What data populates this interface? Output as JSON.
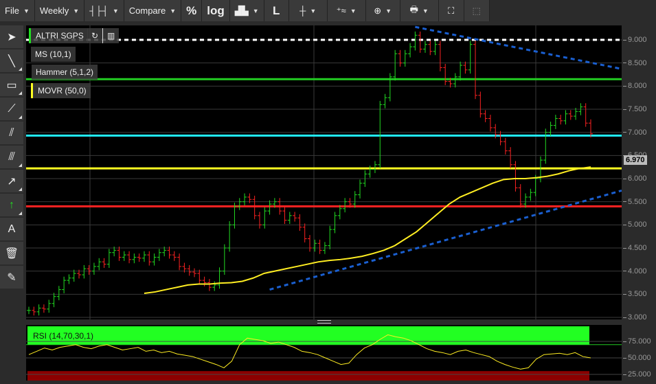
{
  "toolbar": {
    "file": "File",
    "period": "Weekly",
    "compare": "Compare",
    "percent": "%",
    "log": "log",
    "linear": "L"
  },
  "left_tools": [
    "pointer",
    "line",
    "rectangle",
    "fan",
    "parallel-lines",
    "fibonacci",
    "arrow",
    "up-arrow",
    "text",
    "trash",
    "ruler"
  ],
  "left_tools_text_label": "A",
  "legends": {
    "symbol": "ALTRI SGPS",
    "ms": "MS (10,1)",
    "hammer": "Hammer (5,1,2)",
    "movr": "MOVR (50,0)",
    "rsi": "RSI (14,70,30,1)"
  },
  "last_price": "6.970",
  "price_ticks": [
    "9.000",
    "8.500",
    "8.000",
    "7.500",
    "7.000",
    "6.500",
    "6.000",
    "5.500",
    "5.000",
    "4.500",
    "4.000",
    "3.500",
    "3.000"
  ],
  "rsi_ticks": [
    "75.000",
    "50.000",
    "25.000"
  ],
  "colors": {
    "up": "#22dd22",
    "down": "#ff2222",
    "ma": "#ffee22",
    "cyan": "#22eeff",
    "trend": "#1a5fd0"
  },
  "chart_data": {
    "type": "ohlc",
    "ylim": [
      3,
      9.3
    ],
    "closes": [
      3.15,
      3.12,
      3.2,
      3.18,
      3.3,
      3.45,
      3.6,
      3.8,
      3.85,
      3.95,
      3.92,
      4.05,
      4.0,
      4.1,
      4.2,
      4.15,
      4.4,
      4.45,
      4.3,
      4.35,
      4.25,
      4.3,
      4.28,
      4.35,
      4.2,
      4.3,
      4.4,
      4.45,
      4.35,
      4.3,
      4.1,
      4.05,
      3.98,
      3.95,
      3.8,
      3.75,
      3.65,
      3.7,
      4.0,
      4.5,
      5.0,
      5.4,
      5.5,
      5.6,
      5.55,
      5.2,
      5.0,
      5.3,
      5.45,
      5.5,
      5.3,
      5.1,
      5.2,
      5.15,
      4.95,
      4.7,
      4.5,
      4.6,
      4.45,
      4.55,
      4.9,
      5.2,
      5.35,
      5.5,
      5.45,
      5.65,
      5.9,
      6.1,
      6.2,
      6.3,
      7.6,
      7.75,
      8.2,
      8.7,
      8.5,
      8.7,
      8.85,
      9.1,
      8.8,
      8.9,
      8.75,
      8.9,
      8.4,
      8.1,
      8.05,
      8.2,
      8.45,
      8.35,
      8.9,
      7.8,
      7.4,
      7.3,
      7.1,
      6.95,
      6.8,
      6.6,
      6.3,
      5.8,
      5.45,
      5.6,
      5.7,
      6.0,
      6.4,
      7.0,
      7.15,
      7.3,
      7.25,
      7.4,
      7.35,
      7.45,
      7.55,
      7.2,
      6.97
    ],
    "ma": [
      3.52,
      3.55,
      3.6,
      3.65,
      3.7,
      3.72,
      3.72,
      3.74,
      3.75,
      3.78,
      3.85,
      3.95,
      4.0,
      4.05,
      4.1,
      4.15,
      4.2,
      4.23,
      4.25,
      4.28,
      4.32,
      4.38,
      4.45,
      4.55,
      4.7,
      4.85,
      5.05,
      5.25,
      5.45,
      5.6,
      5.7,
      5.8,
      5.9,
      5.98,
      6.0,
      6.0,
      6.02,
      6.05,
      6.1,
      6.17,
      6.22,
      6.25
    ],
    "ma_start_index": 23,
    "hlines": [
      {
        "price": 9.0,
        "color": "#ffffff",
        "dash": true
      },
      {
        "price": 8.15,
        "color": "#22cc22"
      },
      {
        "price": 6.93,
        "color": "#22eeff"
      },
      {
        "price": 6.22,
        "color": "#ffff22"
      },
      {
        "price": 5.4,
        "color": "#ff2222"
      }
    ],
    "trendlines": [
      {
        "from": [
          77,
          9.28
        ],
        "to": [
          125,
          8.22
        ]
      },
      {
        "from": [
          48,
          3.6
        ],
        "to": [
          125,
          5.95
        ]
      }
    ],
    "rsi": {
      "ylim": [
        0,
        100
      ],
      "upper": 70,
      "lower": 30,
      "values": [
        55,
        60,
        65,
        62,
        66,
        68,
        70,
        66,
        64,
        68,
        70,
        66,
        62,
        64,
        66,
        60,
        62,
        58,
        60,
        56,
        54,
        52,
        48,
        44,
        40,
        35,
        45,
        70,
        80,
        78,
        76,
        72,
        74,
        70,
        66,
        60,
        58,
        55,
        50,
        45,
        40,
        42,
        55,
        65,
        70,
        78,
        85,
        82,
        80,
        76,
        70,
        64,
        60,
        58,
        55,
        60,
        62,
        58,
        55,
        52,
        45,
        40,
        36,
        33,
        35,
        48,
        55,
        56,
        57,
        55,
        58,
        52,
        50
      ]
    }
  }
}
